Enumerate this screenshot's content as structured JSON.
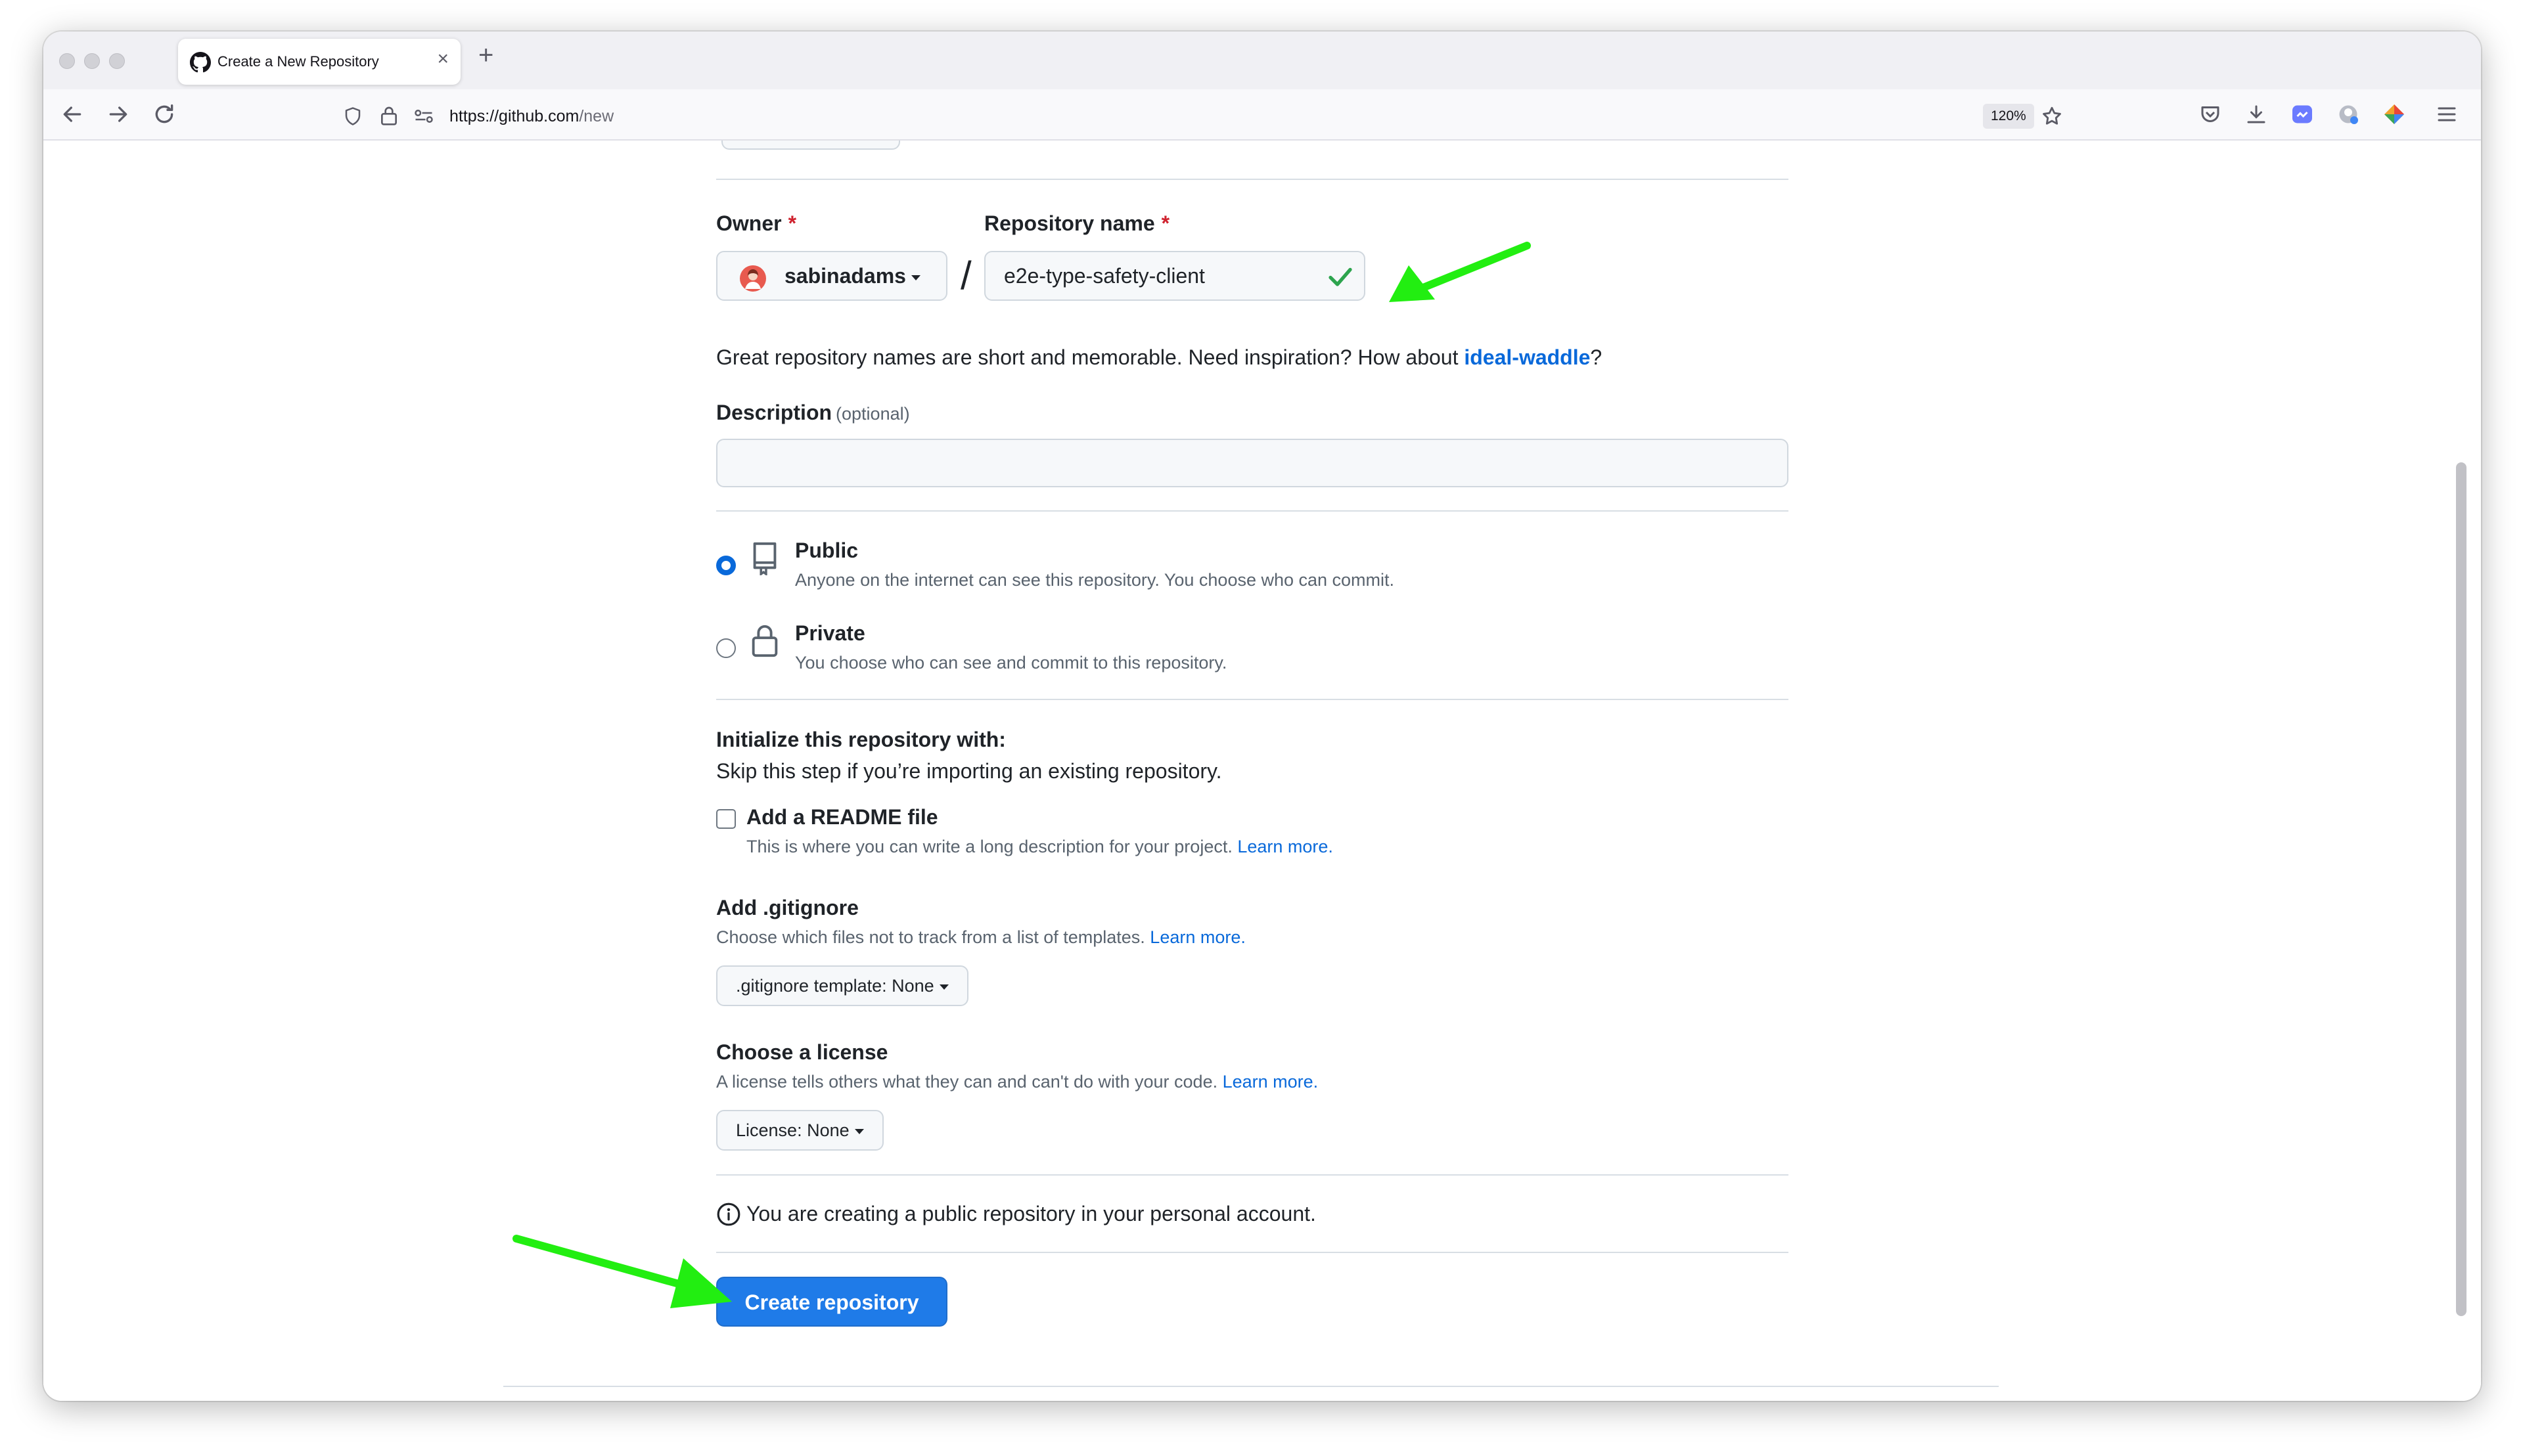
{
  "browser": {
    "tab_title": "Create a New Repository",
    "tab_close": "×",
    "new_tab": "+",
    "url_host": "https://github.com",
    "url_path": "/new",
    "zoom": "120%"
  },
  "form": {
    "owner_label": "Owner",
    "required_marker": "*",
    "owner_name": "sabinadams",
    "separator": "/",
    "repo_label": "Repository name",
    "repo_value": "e2e-type-safety-client",
    "name_hint_prefix": "Great repository names are short and memorable. Need inspiration? How about ",
    "name_suggestion": "ideal-waddle",
    "name_hint_suffix": "?",
    "description_label": "Description",
    "description_optional": "(optional)",
    "description_value": ""
  },
  "visibility": {
    "public_title": "Public",
    "public_desc": "Anyone on the internet can see this repository. You choose who can commit.",
    "private_title": "Private",
    "private_desc": "You choose who can see and commit to this repository."
  },
  "initialize": {
    "heading": "Initialize this repository with:",
    "subtext": "Skip this step if you’re importing an existing repository.",
    "readme_label": "Add a README file",
    "readme_desc": "This is where you can write a long description for your project.",
    "learn_more": "Learn more.",
    "gitignore_heading": "Add .gitignore",
    "gitignore_desc": "Choose which files not to track from a list of templates.",
    "gitignore_select": ".gitignore template: None",
    "license_heading": "Choose a license",
    "license_desc": "A license tells others what they can and can't do with your code.",
    "license_select": "License: None"
  },
  "notice": "You are creating a public repository in your personal account.",
  "submit_label": "Create repository",
  "colors": {
    "primary_button": "#1f7be8",
    "link": "#0969da",
    "required": "#cf222e",
    "annotation_arrow": "#22ee11",
    "valid_check": "#2da44e"
  }
}
